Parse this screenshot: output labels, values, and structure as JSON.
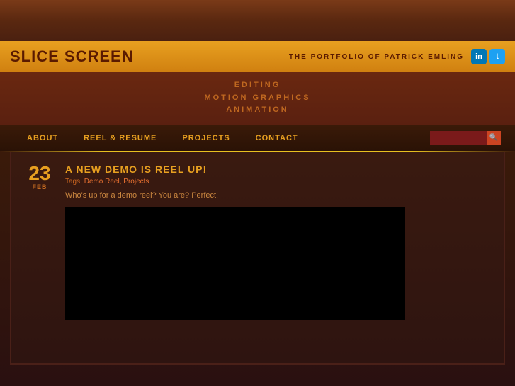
{
  "site": {
    "title": "SLICE SCREEN",
    "tagline": "THE PORTFOLIO OF PATRICK EMLING"
  },
  "header": {
    "subtitle_lines": [
      "EDITING",
      "MOTION GRAPHICS",
      "ANIMATION"
    ]
  },
  "nav": {
    "items": [
      {
        "label": "ABOUT",
        "id": "about"
      },
      {
        "label": "REEL & RESUME",
        "id": "reel"
      },
      {
        "label": "PROJECTS",
        "id": "projects"
      },
      {
        "label": "CONTACT",
        "id": "contact"
      }
    ],
    "search_placeholder": ""
  },
  "social": {
    "linkedin_label": "in",
    "twitter_label": "t"
  },
  "post": {
    "day": "23",
    "month": "Feb",
    "title": "A NEW DEMO IS REEL UP!",
    "tags_label": "Tags:",
    "tags": [
      "Demo Reel",
      "Projects"
    ],
    "excerpt": "Who's up for a demo reel? You are? Perfect!"
  }
}
